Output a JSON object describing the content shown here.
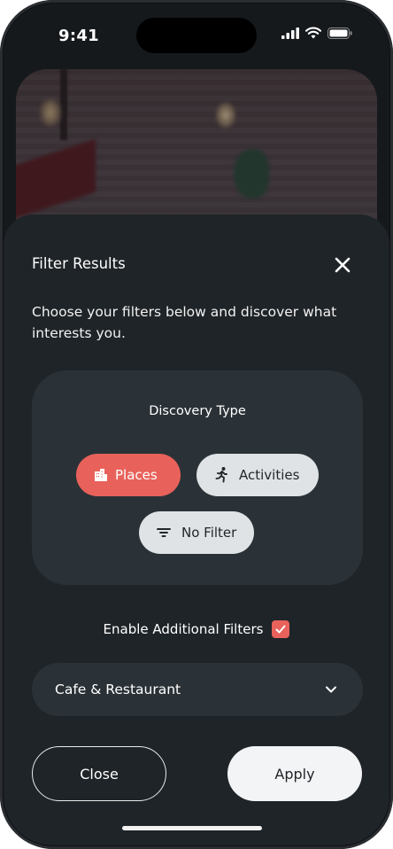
{
  "status_bar": {
    "time": "9:41"
  },
  "sheet": {
    "title": "Filter Results",
    "description": "Choose your filters below and discover what interests you.",
    "discovery": {
      "title": "Discovery Type",
      "options": [
        {
          "label": "Places",
          "icon": "buildings-icon",
          "selected": true
        },
        {
          "label": "Activities",
          "icon": "running-person-icon",
          "selected": false
        },
        {
          "label": "No Filter",
          "icon": "filter-lines-icon",
          "selected": false
        }
      ]
    },
    "additional_filters": {
      "label": "Enable Additional Filters",
      "checked": true
    },
    "category_select": {
      "value": "Cafe & Restaurant"
    },
    "buttons": {
      "close": "Close",
      "apply": "Apply"
    }
  },
  "colors": {
    "accent": "#e8625b",
    "sheet_bg": "#1f2428",
    "card_bg": "#2b3237",
    "chip_inactive": "#dfe3e5"
  }
}
